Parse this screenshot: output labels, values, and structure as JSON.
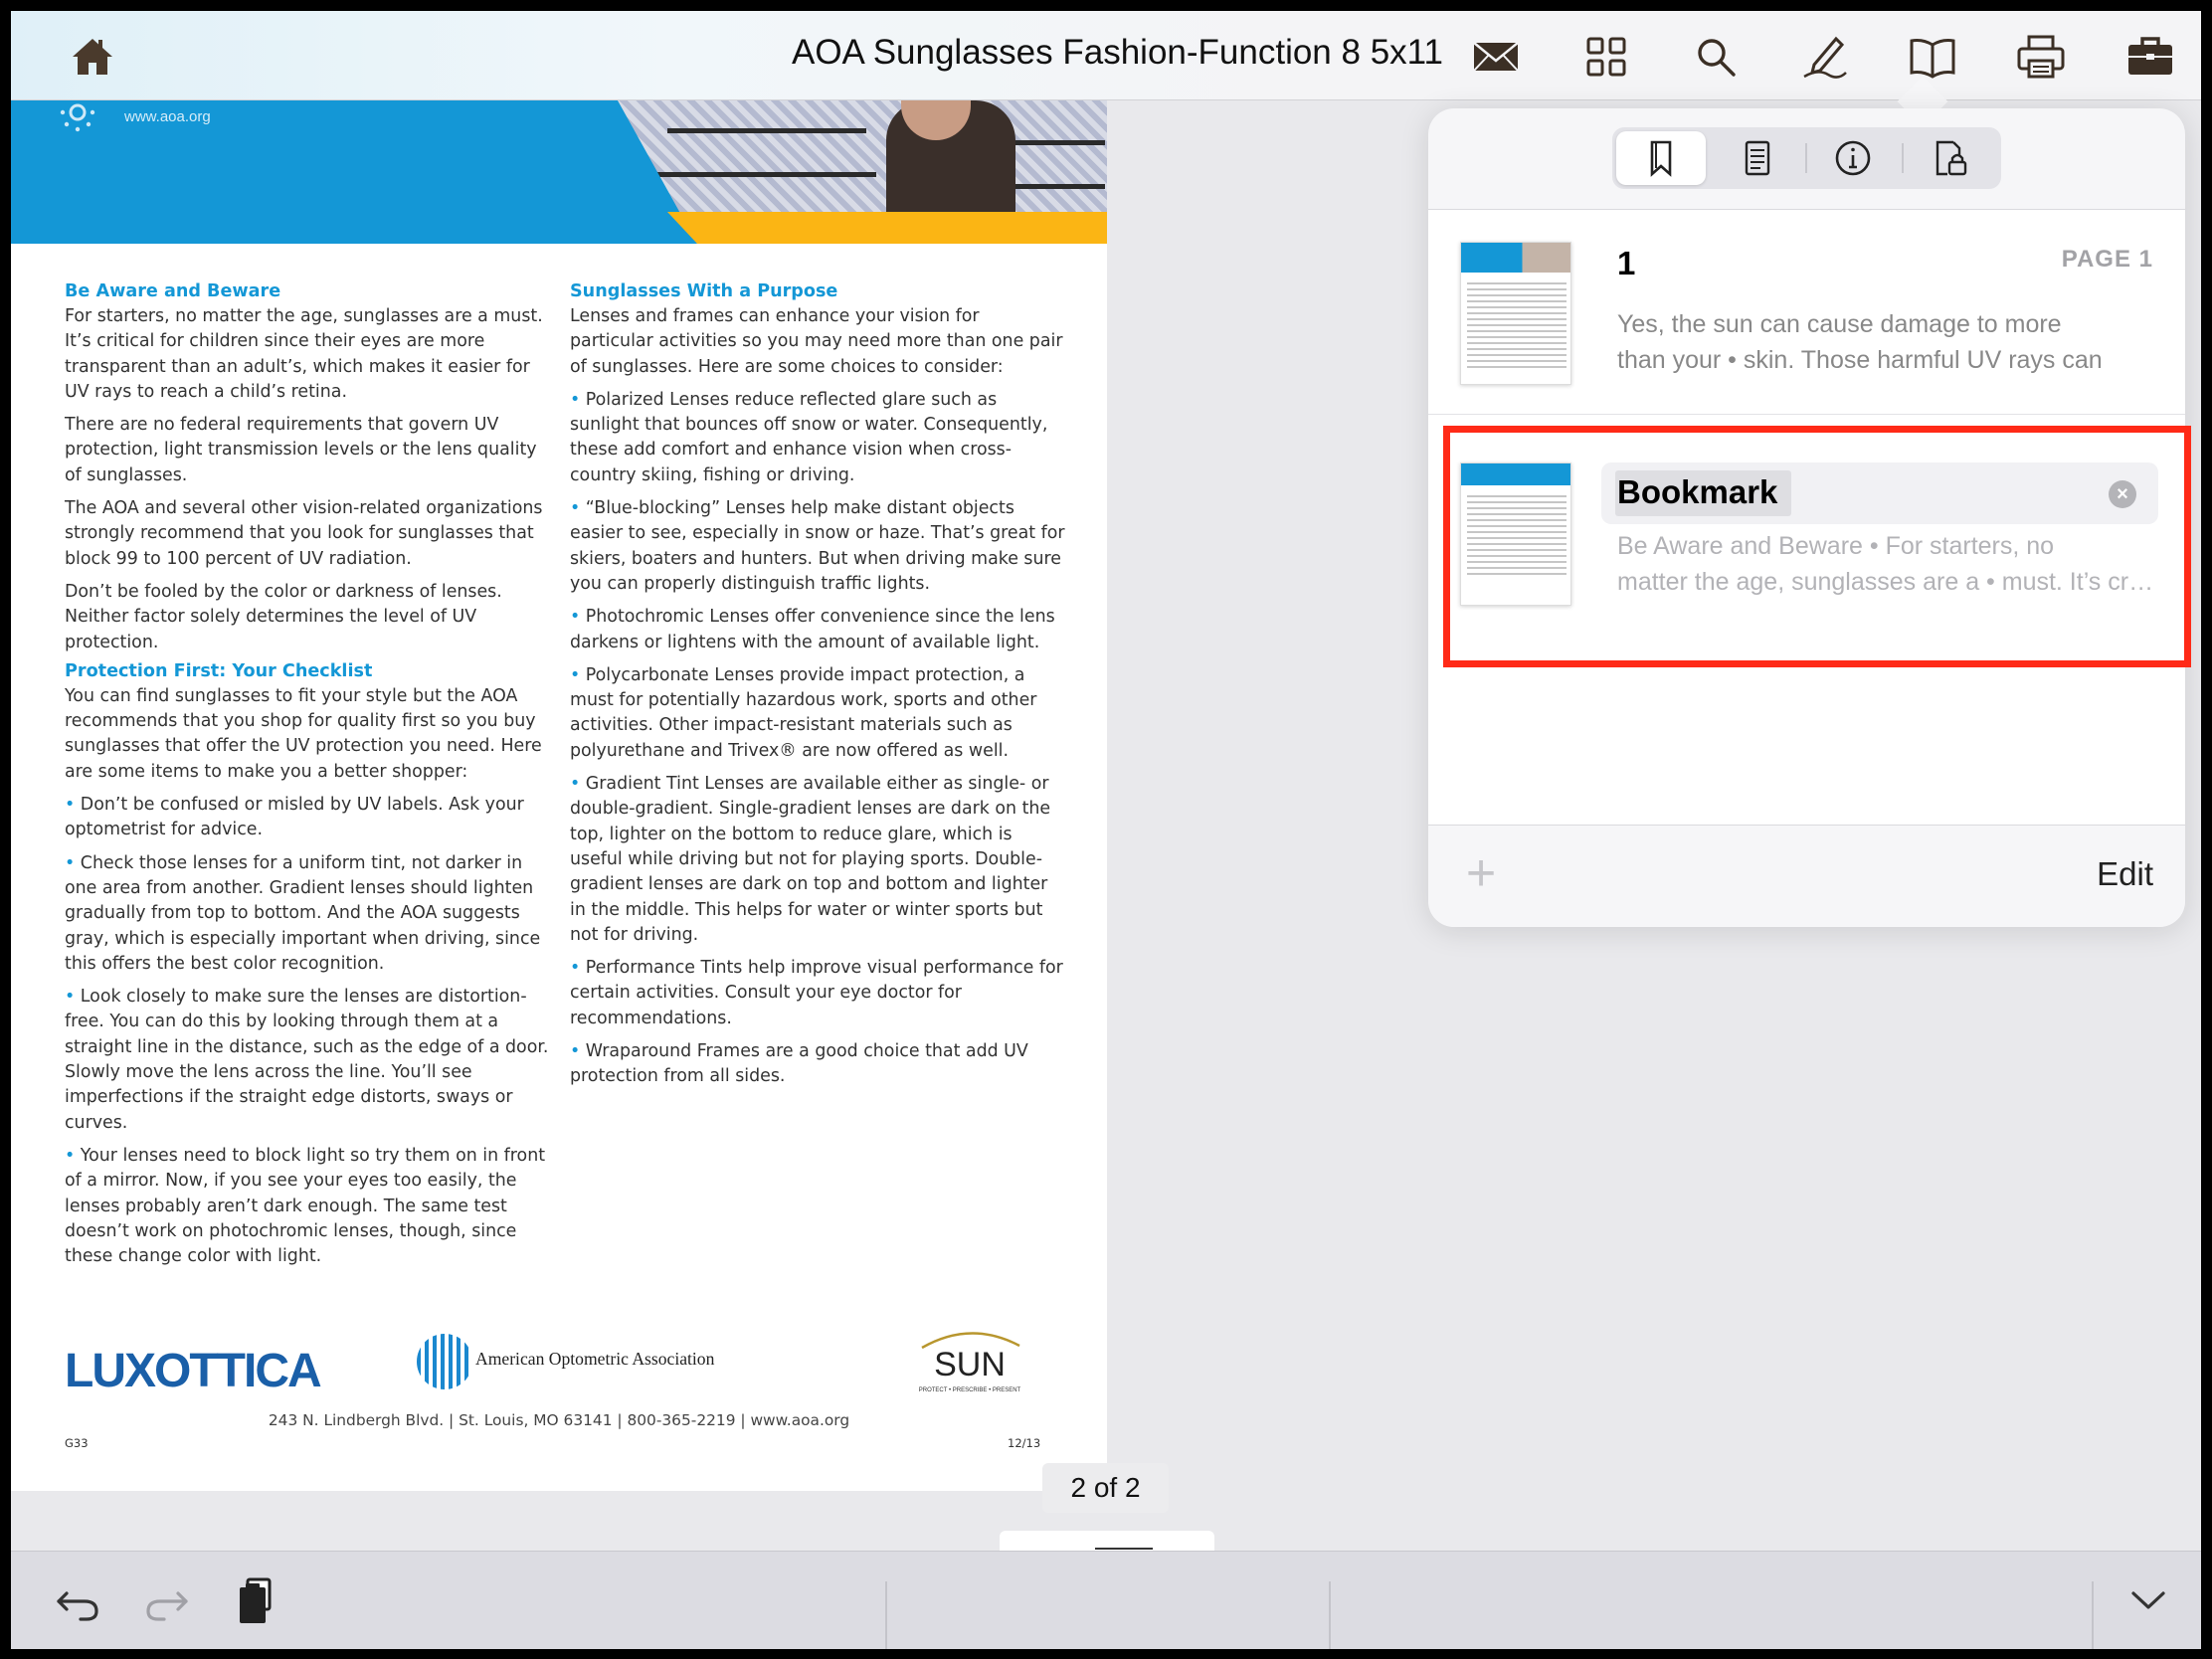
{
  "toolbar": {
    "title": "AOA Sunglasses Fashion-Function 8 5x11",
    "icons": [
      "home-icon",
      "mail-icon",
      "thumbnails-icon",
      "search-icon",
      "annotate-icon",
      "bookmarks-icon",
      "print-icon",
      "briefcase-icon"
    ]
  },
  "document": {
    "header_url": "www.aoa.org",
    "left_column": {
      "heading1": "Be Aware and Beware",
      "p1": "For starters, no matter the age, sunglasses are a must. It’s critical for children since their eyes are more transparent than an adult’s, which makes it easier for UV rays to reach a child’s retina.",
      "p2": "There are no federal requirements that govern UV protection, light transmission levels or the lens quality of sunglasses.",
      "p3": "The AOA and several other vision-related organizations strongly recommend that you look for sunglasses that block 99 to 100 percent of UV radiation.",
      "p4": "Don’t be fooled by the color or darkness of lenses. Neither factor solely determines the level of UV protection.",
      "heading2": "Protection First: Your Checklist",
      "p5": "You can find sunglasses to fit your style but the AOA recommends that you shop for quality first so you buy sunglasses that offer the UV protection you need. Here are some items to make you a better shopper:",
      "b1": "Don’t be confused or misled by UV labels. Ask your optometrist for advice.",
      "b2": "Check those lenses for a uniform tint, not darker in one area from another. Gradient lenses should lighten gradually from top to bottom. And the AOA suggests gray, which is especially important when driving, since this offers the best color recognition.",
      "b3": "Look closely to make sure the lenses are distortion-free. You can do this by looking through them at a straight line in the distance, such as the edge of a door. Slowly move the lens across the line. You’ll see imperfections if the straight edge distorts, sways or curves.",
      "b4": "Your lenses need to block light so try them on in front of a mirror. Now, if you see your eyes too easily, the lenses probably aren’t dark enough. The same test doesn’t work on photochromic lenses, though, since these change color with light."
    },
    "right_column": {
      "heading": "Sunglasses With a Purpose",
      "p1": "Lenses and frames can enhance your vision for particular activities so you may need more than one pair of sunglasses. Here are some choices to consider:",
      "b1": "Polarized Lenses reduce reflected glare such as sunlight that bounces off snow or water. Consequently, these add comfort and enhance vision when cross-country skiing, fishing or driving.",
      "b2": "“Blue-blocking” Lenses help make distant objects easier to see, especially in snow or haze. That’s great for skiers, boaters and hunters. But when driving make sure you can properly distinguish traffic lights.",
      "b3": "Photochromic Lenses offer convenience since the lens darkens or lightens with the amount of available light.",
      "b4": "Polycarbonate Lenses provide impact protection, a must for potentially hazardous work, sports and other activities. Other impact-resistant materials such as polyurethane and Trivex® are now offered as well.",
      "b5": "Gradient Tint Lenses are available either as single- or double-gradient. Single-gradient lenses are dark on the top, lighter on the bottom to reduce glare, which is useful while driving but not for playing sports. Double-gradient lenses are dark on top and bottom and lighter in the middle. This helps for water or winter sports but not for driving.",
      "b6": "Performance Tints help improve visual performance for certain activities. Consult your eye doctor for recommendations.",
      "b7": "Wraparound Frames are a good choice that add UV protection from all sides."
    },
    "footer": {
      "logo_luxottica": "LUXOTTICA",
      "logo_aoa": "American Optometric Association",
      "logo_sun": "SUN",
      "logo_sun_tagline": "PROTECT • PRESCRIBE • PRESENT",
      "address": "243 N. Lindbergh Blvd. | St. Louis, MO 63141 | 800-365-2219 | www.aoa.org",
      "code_left": "G33",
      "code_right": "12/13"
    },
    "page_indicator": "2 of 2"
  },
  "popover": {
    "segments": [
      "bookmark-tab-icon",
      "outline-tab-icon",
      "info-tab-icon",
      "security-tab-icon"
    ],
    "active_segment": 0,
    "bookmarks": [
      {
        "title": "1",
        "page_tag": "PAGE 1",
        "preview_line1": "Yes, the sun can cause damage to more",
        "preview_line2": "than your • skin. Those harmful UV rays can"
      },
      {
        "title": "Bookmark",
        "preview_line1": "Be Aware and Beware • For starters, no",
        "preview_line2": "matter the age, sunglasses are a • must. It’s critical"
      }
    ],
    "footer": {
      "add_label": "+",
      "edit_label": "Edit"
    }
  },
  "colors": {
    "accent_blue": "#1497d6",
    "accent_yellow": "#fbb514",
    "highlight_red": "#ff2a17"
  }
}
